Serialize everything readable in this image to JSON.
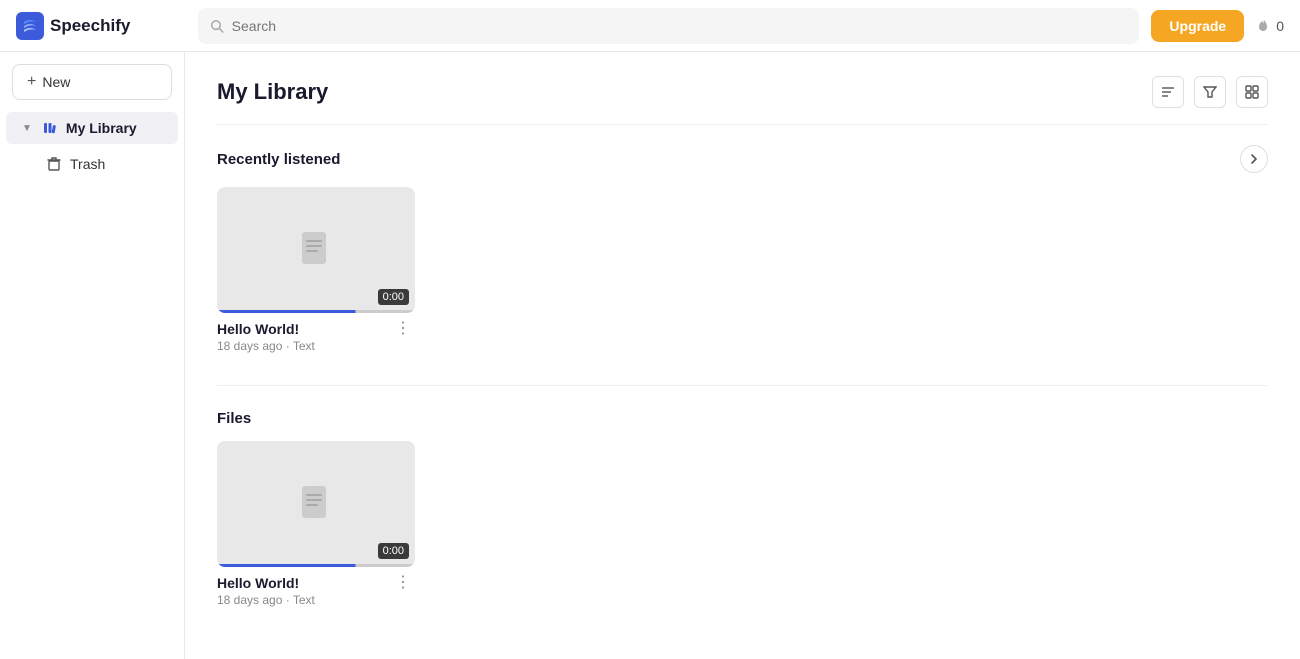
{
  "topbar": {
    "logo_text": "Speechify",
    "search_placeholder": "Search",
    "upgrade_label": "Upgrade",
    "credits_count": "0"
  },
  "sidebar": {
    "new_button_label": "New",
    "items": [
      {
        "id": "my-library",
        "label": "My Library",
        "active": true,
        "has_chevron": true
      },
      {
        "id": "trash",
        "label": "Trash",
        "active": false,
        "has_chevron": false
      }
    ]
  },
  "main": {
    "page_title": "My Library",
    "header_icons": [
      "sort-icon",
      "filter-icon",
      "grid-icon"
    ],
    "sections": [
      {
        "id": "recently-listened",
        "title": "Recently listened",
        "show_nav": true,
        "cards": [
          {
            "id": "card-1",
            "title": "Hello World!",
            "meta": "18 days ago",
            "type": "Text",
            "duration": "0:00"
          }
        ]
      },
      {
        "id": "files",
        "title": "Files",
        "show_nav": false,
        "cards": [
          {
            "id": "card-2",
            "title": "Hello World!",
            "meta": "18 days ago",
            "type": "Text",
            "duration": "0:00"
          }
        ]
      }
    ]
  }
}
